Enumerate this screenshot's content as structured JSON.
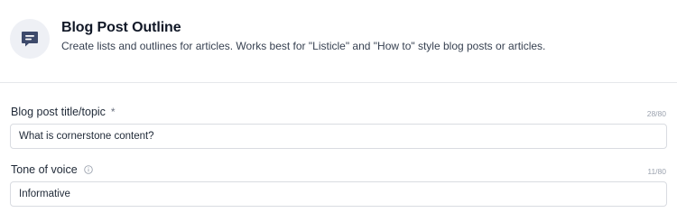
{
  "header": {
    "icon": "message-text-icon",
    "title": "Blog Post Outline",
    "subtitle": "Create lists and outlines for articles. Works best for \"Listicle\" and \"How to\" style blog posts or articles."
  },
  "fields": [
    {
      "label": "Blog post title/topic",
      "required_marker": "*",
      "counter": "28/80",
      "value": "What is cornerstone content?"
    },
    {
      "label": "Tone of voice",
      "info_icon": "info-icon",
      "counter": "11/80",
      "value": "Informative"
    }
  ],
  "colors": {
    "icon_bg": "#eef0f5",
    "icon_fg": "#3d4a6b",
    "border": "#d9dce1"
  }
}
